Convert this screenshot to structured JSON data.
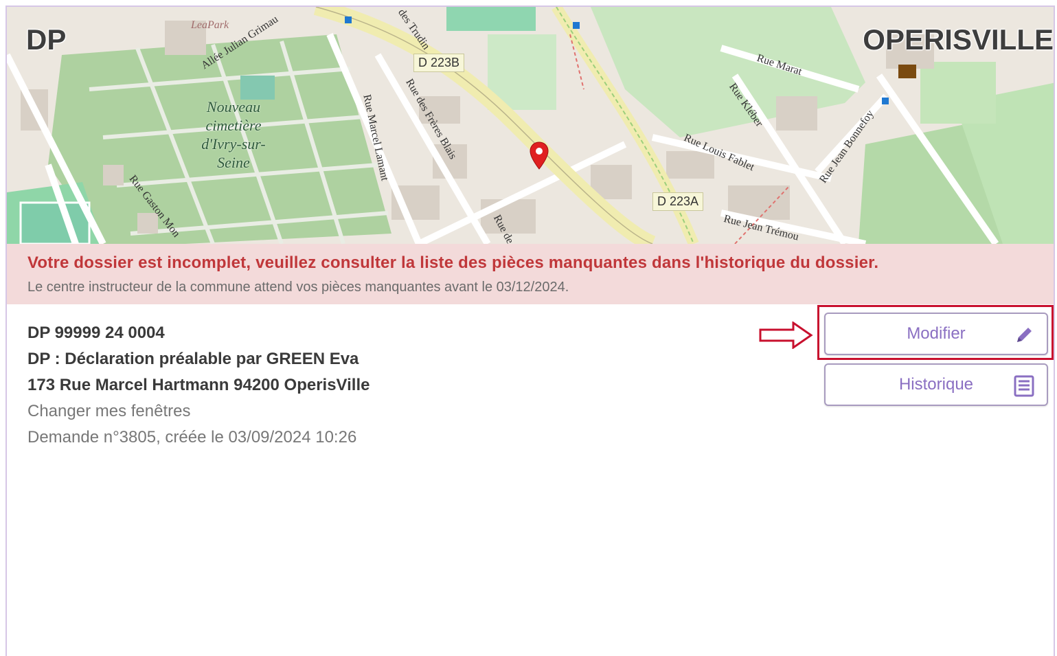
{
  "map": {
    "dossier_type": "DP",
    "commune": "OPERISVILLE",
    "labels": {
      "leapark": "LeaPark",
      "allee": "Allée Julian Grimau",
      "cemetery_1": "Nouveau",
      "cemetery_2": "cimetière",
      "cemetery_3": "d'Ivry-sur-",
      "cemetery_4": "Seine",
      "gaston": "Rue Gaston Mon",
      "marcel_lamant": "Rue Marcel Lamant",
      "freres_blais": "Rue des Frères Blais",
      "trudin": "des Trudin",
      "d223b": "D 223B",
      "d223a": "D 223A",
      "marat": "Rue Marat",
      "kleber": "Rue Kléber",
      "louis_fablet": "Rue Louis Fablet",
      "jean_bonnefoy": "Rue Jean Bonnefoy",
      "jean_tremoulet": "Rue Jean Trémou",
      "rue_de": "Rue de"
    }
  },
  "alert": {
    "title": "Votre dossier est incomplet, veuillez consulter la liste des pièces manquantes dans l'historique du dossier.",
    "subtitle": "Le centre instructeur de la commune attend vos pièces manquantes avant le 03/12/2024."
  },
  "dossier": {
    "number": "DP 99999 24 0004",
    "type_line": "DP : Déclaration préalable par GREEN Eva",
    "address": "173 Rue Marcel Hartmann 94200 OperisVille",
    "description": "Changer mes fenêtres",
    "request_line": "Demande n°3805, créée le 03/09/2024 10:26"
  },
  "actions": {
    "modifier_label": "Modifier",
    "historique_label": "Historique"
  },
  "icons": {
    "modifier": "pencil-icon",
    "historique": "list-document-icon",
    "map_marker": "location-pin-icon",
    "annotation": "right-arrow-icon"
  },
  "colors": {
    "alert_bg": "#f3dada",
    "alert_text": "#c0373a",
    "button_text": "#8a6fc2",
    "highlight": "#c8102e"
  }
}
